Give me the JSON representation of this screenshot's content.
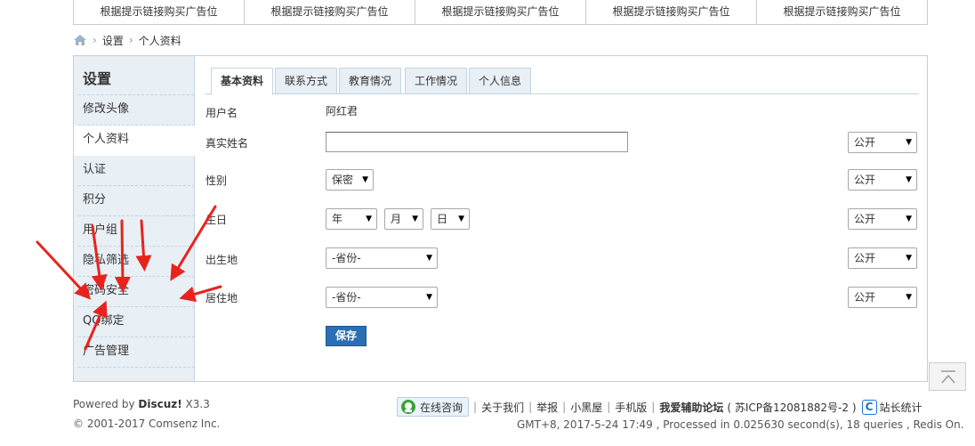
{
  "ads": [
    "根据提示链接购买广告位",
    "根据提示链接购买广告位",
    "根据提示链接购买广告位",
    "根据提示链接购买广告位",
    "根据提示链接购买广告位"
  ],
  "breadcrumb": {
    "items": [
      "设置",
      "个人资料"
    ]
  },
  "sidebar": {
    "title": "设置",
    "items": [
      {
        "label": "修改头像"
      },
      {
        "label": "个人资料"
      },
      {
        "label": "认证"
      },
      {
        "label": "积分"
      },
      {
        "label": "用户组"
      },
      {
        "label": "隐私筛选"
      },
      {
        "label": "密码安全"
      },
      {
        "label": "QQ绑定"
      },
      {
        "label": "广告管理"
      }
    ]
  },
  "tabs": [
    "基本资料",
    "联系方式",
    "教育情况",
    "工作情况",
    "个人信息"
  ],
  "form": {
    "username_label": "用户名",
    "username_value": "阿红君",
    "realname_label": "真实姓名",
    "realname_value": "",
    "gender_label": "性别",
    "gender_value": "保密",
    "birthday_label": "生日",
    "year_value": "年",
    "month_value": "月",
    "day_value": "日",
    "birthplace_label": "出生地",
    "birthplace_value": "-省份-",
    "residence_label": "居住地",
    "residence_value": "-省份-",
    "privacy_value": "公开",
    "save_label": "保存"
  },
  "footer": {
    "powered_prefix": "Powered by ",
    "powered_brand": "Discuz!",
    "powered_version": " X3.3",
    "copyright": "© 2001-2017 Comsenz Inc.",
    "online_consult": "在线咨询",
    "links": [
      "关于我们",
      "举报",
      "小黑屋",
      "手机版"
    ],
    "forum_name": "我爱辅助论坛",
    "icp": "( 苏ICP备12081882号-2 )",
    "stats": "站长统计",
    "status": "GMT+8, 2017-5-24 17:49 , Processed in 0.025630 second(s), 18 queries , Redis On."
  },
  "colors": {
    "save": "#2b6eb3",
    "sidebar_bg": "#e8eff5",
    "arrows": "#e8231e"
  }
}
